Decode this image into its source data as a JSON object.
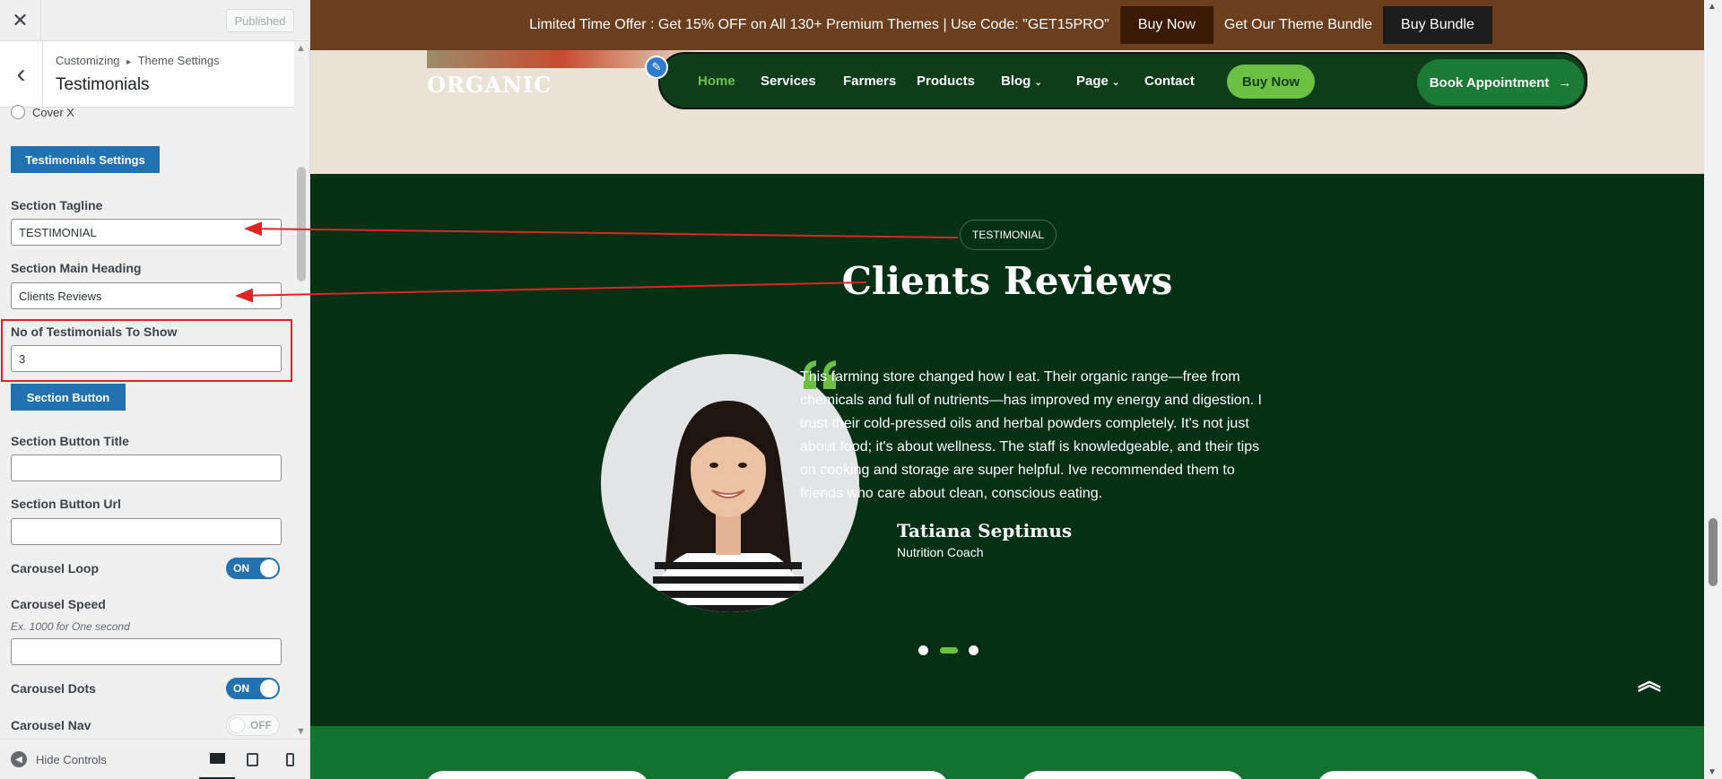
{
  "customizer": {
    "published_label": "Published",
    "breadcrumb_root": "Customizing",
    "breadcrumb_separator": "▸",
    "breadcrumb_parent": "Theme Settings",
    "section_title": "Testimonials",
    "cover_option_label": "Cover X",
    "settings_heading_button": "Testimonials Settings",
    "fields": {
      "tagline_label": "Section Tagline",
      "tagline_value": "TESTIMONIAL",
      "heading_label": "Section Main Heading",
      "heading_value": "Clients Reviews",
      "count_label": "No of Testimonials To Show",
      "count_value": "3",
      "button_section_label": "Section Button",
      "button_title_label": "Section Button Title",
      "button_title_value": "",
      "button_url_label": "Section Button Url",
      "button_url_value": "",
      "loop_label": "Carousel Loop",
      "loop_state": "ON",
      "speed_label": "Carousel Speed",
      "speed_hint": "Ex. 1000 for One second",
      "speed_value": "",
      "dots_label": "Carousel Dots",
      "dots_state": "ON",
      "nav_label": "Carousel Nav",
      "nav_state": "OFF"
    },
    "footer": {
      "hide_controls_label": "Hide Controls",
      "devices": [
        "desktop-icon",
        "tablet-icon",
        "mobile-icon"
      ]
    },
    "colors": {
      "accent": "#2271b1",
      "highlight": "#e02424"
    }
  },
  "site": {
    "promo": {
      "text": "Limited Time Offer : Get 15% OFF on All 130+ Premium Themes | Use Code: \"GET15PRO\"",
      "buy_now_label": "Buy Now",
      "bundle_text": "Get Our Theme Bundle",
      "buy_bundle_label": "Buy Bundle"
    },
    "logo_text": "ORGANIC",
    "nav": {
      "items": [
        "Home",
        "Services",
        "Farmers",
        "Products",
        "Blog",
        "Page",
        "Contact"
      ],
      "buy_now_label": "Buy Now",
      "book_label": "Book Appointment",
      "active": "Home"
    },
    "testimonials": {
      "tagline": "TESTIMONIAL",
      "heading": "Clients Reviews",
      "quote": "This farming store changed how I eat. Their organic range—free from chemicals and full of nutrients—has improved my energy and digestion. I trust their cold-pressed oils and herbal powders completely. It's not just about food; it's about wellness. The staff is knowledgeable, and their tips on cooking and storage are super helpful. Ive recommended them to friends who care about clean, conscious eating.",
      "name": "Tatiana Septimus",
      "role": "Nutrition Coach",
      "active_dot": 1,
      "dot_count": 3
    },
    "colors": {
      "dark_green": "#053014",
      "light_green": "#6cc043",
      "promo_brown": "#6b3e1e",
      "beige": "#ebe2d6"
    }
  }
}
